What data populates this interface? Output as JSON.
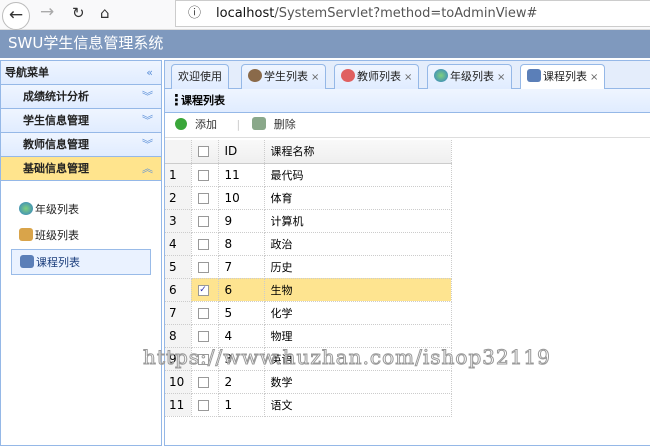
{
  "browser": {
    "url_host": "localhost",
    "url_path": "/SystemServlet?method=toAdminView#"
  },
  "header": {
    "title": "SWU学生信息管理系统"
  },
  "sidebar": {
    "title": "导航菜单",
    "sections": [
      {
        "label": "成绩统计分析"
      },
      {
        "label": "学生信息管理"
      },
      {
        "label": "教师信息管理"
      },
      {
        "label": "基础信息管理"
      }
    ],
    "items": [
      {
        "label": "年级列表"
      },
      {
        "label": "班级列表"
      },
      {
        "label": "课程列表"
      }
    ]
  },
  "tabs": [
    {
      "label": "欢迎使用"
    },
    {
      "label": "学生列表"
    },
    {
      "label": "教师列表"
    },
    {
      "label": "年级列表"
    },
    {
      "label": "课程列表"
    }
  ],
  "panel": {
    "title": "课程列表",
    "add": "添加",
    "delete": "删除"
  },
  "grid": {
    "columns": [
      "ID",
      "课程名称"
    ],
    "rows": [
      {
        "n": "1",
        "id": "11",
        "name": "最代码"
      },
      {
        "n": "2",
        "id": "10",
        "name": "体育"
      },
      {
        "n": "3",
        "id": "9",
        "name": "计算机"
      },
      {
        "n": "4",
        "id": "8",
        "name": "政治"
      },
      {
        "n": "5",
        "id": "7",
        "name": "历史"
      },
      {
        "n": "6",
        "id": "6",
        "name": "生物"
      },
      {
        "n": "7",
        "id": "5",
        "name": "化学"
      },
      {
        "n": "8",
        "id": "4",
        "name": "物理"
      },
      {
        "n": "9",
        "id": "3",
        "name": "英语"
      },
      {
        "n": "10",
        "id": "2",
        "name": "数学"
      },
      {
        "n": "11",
        "id": "1",
        "name": "语文"
      }
    ],
    "selected_row": 6
  },
  "watermark": "https://www.huzhan.com/ishop32119"
}
